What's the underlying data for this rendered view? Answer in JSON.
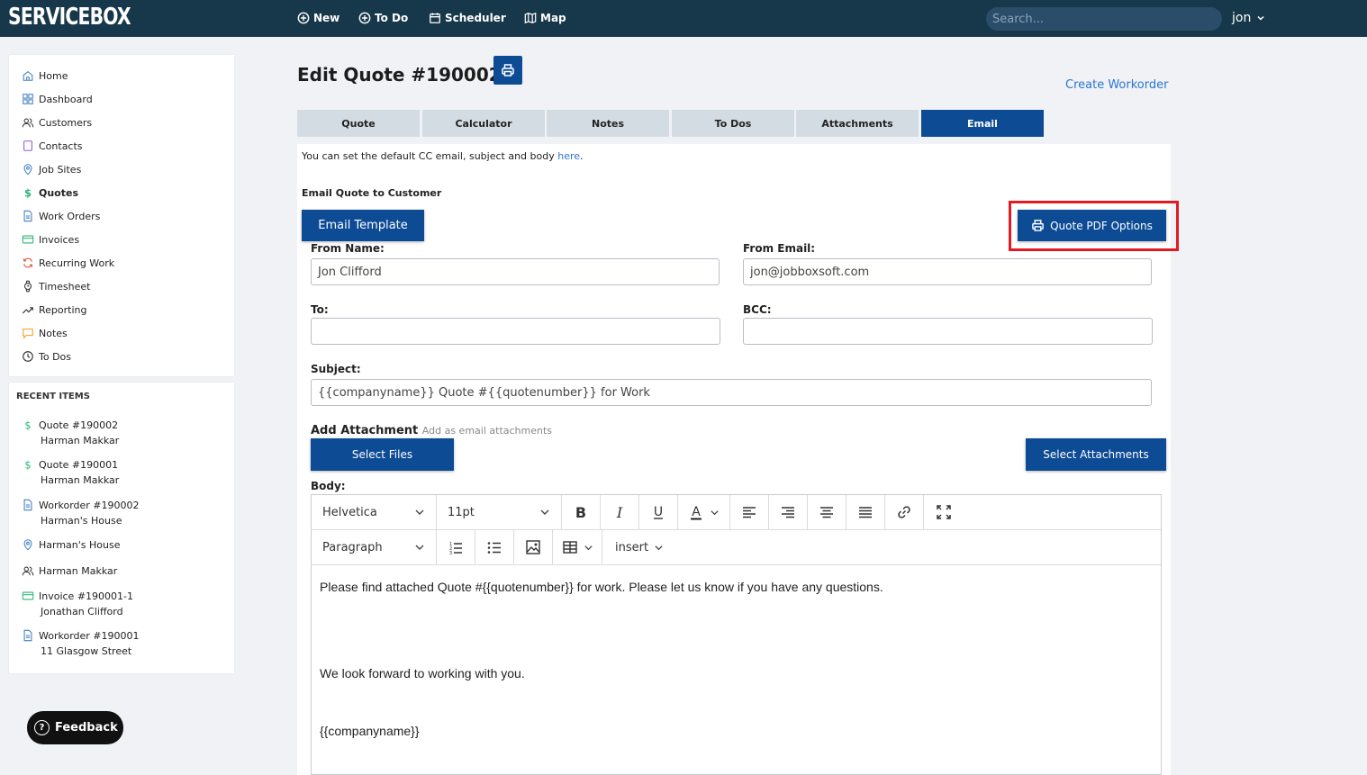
{
  "app": {
    "logo": "SERVICEBOX"
  },
  "topnav": {
    "new": "New",
    "todo": "To Do",
    "scheduler": "Scheduler",
    "map": "Map",
    "search_placeholder": "Search...",
    "user": "jon"
  },
  "sidebar": {
    "items": [
      {
        "label": "Home",
        "icon": "home-icon"
      },
      {
        "label": "Dashboard",
        "icon": "dashboard-icon"
      },
      {
        "label": "Customers",
        "icon": "users-icon"
      },
      {
        "label": "Contacts",
        "icon": "contacts-icon"
      },
      {
        "label": "Job Sites",
        "icon": "location-pin-icon"
      },
      {
        "label": "Quotes",
        "icon": "dollar-icon"
      },
      {
        "label": "Work Orders",
        "icon": "document-icon"
      },
      {
        "label": "Invoices",
        "icon": "card-icon"
      },
      {
        "label": "Recurring Work",
        "icon": "refresh-icon"
      },
      {
        "label": "Timesheet",
        "icon": "watch-icon"
      },
      {
        "label": "Reporting",
        "icon": "trend-icon"
      },
      {
        "label": "Notes",
        "icon": "note-icon"
      },
      {
        "label": "To Dos",
        "icon": "clock-icon"
      }
    ]
  },
  "recent": {
    "title": "RECENT ITEMS",
    "items": [
      {
        "title": "Quote #190002",
        "sub": "Harman Makkar"
      },
      {
        "title": "Quote #190001",
        "sub": "Harman Makkar"
      },
      {
        "title": "Workorder #190002",
        "sub": "Harman's House"
      },
      {
        "title": "Harman's House",
        "sub": ""
      },
      {
        "title": "Harman Makkar",
        "sub": ""
      },
      {
        "title": "Invoice #190001-1",
        "sub": "Jonathan Clifford"
      },
      {
        "title": "Workorder #190001",
        "sub": "11 Glasgow Street"
      }
    ]
  },
  "feedback": "Feedback",
  "page": {
    "title": "Edit Quote #190002",
    "create_workorder": "Create Workorder",
    "tabs": [
      "Quote",
      "Calculator",
      "Notes",
      "To Dos",
      "Attachments",
      "Email"
    ],
    "active_tab": "Email"
  },
  "email": {
    "info_prefix": "You can set the default CC email, subject and body ",
    "info_link": "here",
    "info_suffix": ".",
    "section_title": "Email Quote to Customer",
    "template_button": "Email Template",
    "pdf_button": "Quote PDF Options",
    "from_name_label": "From Name:",
    "from_name_value": "Jon Clifford",
    "from_email_label": "From Email:",
    "from_email_value": "jon@jobboxsoft.com",
    "to_label": "To:",
    "to_value": "",
    "bcc_label": "BCC:",
    "bcc_value": "",
    "subject_label": "Subject:",
    "subject_value": "{{companyname}} Quote #{{quotenumber}} for Work",
    "attach_label": "Add Attachment",
    "attach_hint": "Add as email attachments",
    "select_files": "Select Files",
    "select_attachments": "Select Attachments",
    "body_label": "Body:"
  },
  "editor": {
    "font": "Helvetica",
    "size": "11pt",
    "block": "Paragraph",
    "insert": "insert",
    "body_lines": [
      "Please find attached Quote #{{quotenumber}} for work. Please let us know if you have any questions.",
      "We look forward to working with you.",
      "{{companyname}}"
    ]
  },
  "colors": {
    "topbar": "#17384a",
    "primary": "#0d4b95",
    "link": "#2b74d4",
    "highlight": "#e01b22",
    "quote_icon": "#2bb673"
  }
}
